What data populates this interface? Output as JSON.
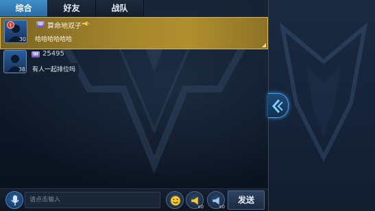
{
  "tabs": [
    {
      "label": "综合",
      "active": true
    },
    {
      "label": "好友",
      "active": false
    },
    {
      "label": "战队",
      "active": false
    }
  ],
  "messages": [
    {
      "name": "算命地双子",
      "level": "30",
      "badge": "!",
      "rank": "III",
      "text": "哈哈哈哈哈哈",
      "highlighted": true,
      "icon": "horn-icon"
    },
    {
      "name": "25495",
      "level": "38",
      "rank": "III",
      "text": "有人一起排位吗",
      "highlighted": false
    }
  ],
  "input": {
    "placeholder": "请点击输入"
  },
  "buttons": {
    "send_label": "发送",
    "horn_small_count": "x0",
    "horn_large_count": "x0"
  },
  "colors": {
    "accent_tab": "#3f8ec9",
    "highlight_message": "#b08f2e",
    "glow": "#4aa0e0"
  }
}
